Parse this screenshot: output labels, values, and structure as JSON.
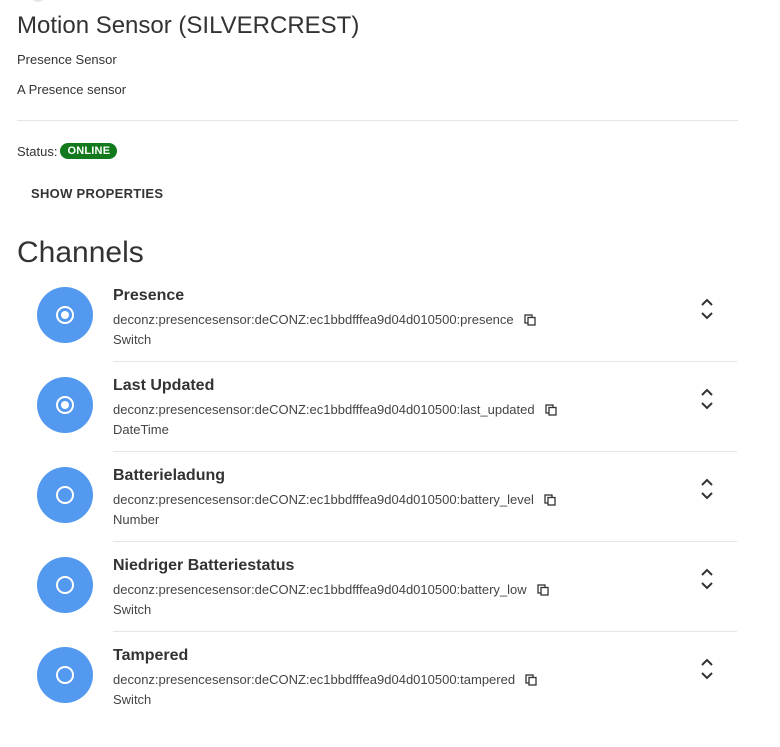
{
  "thing": {
    "title": "Motion Sensor (SILVERCREST)",
    "type_label": "Presence Sensor",
    "description": "A Presence sensor"
  },
  "status": {
    "label": "Status:",
    "value": "ONLINE",
    "color": "#127a1c"
  },
  "actions": {
    "show_properties": "SHOW PROPERTIES"
  },
  "channels_heading": "Channels",
  "accent": "#5399f0",
  "channels": [
    {
      "label": "Presence",
      "uid": "deconz:presencesensor:deCONZ:ec1bbdfffea9d04d010500:presence",
      "item_type": "Switch",
      "icon": "radio-checked-icon",
      "linked": true
    },
    {
      "label": "Last Updated",
      "uid": "deconz:presencesensor:deCONZ:ec1bbdfffea9d04d010500:last_updated",
      "item_type": "DateTime",
      "icon": "radio-checked-icon",
      "linked": true
    },
    {
      "label": "Batterieladung",
      "uid": "deconz:presencesensor:deCONZ:ec1bbdfffea9d04d010500:battery_level",
      "item_type": "Number",
      "icon": "radio-unchecked-icon",
      "linked": false
    },
    {
      "label": "Niedriger Batteriestatus",
      "uid": "deconz:presencesensor:deCONZ:ec1bbdfffea9d04d010500:battery_low",
      "item_type": "Switch",
      "icon": "radio-unchecked-icon",
      "linked": false
    },
    {
      "label": "Tampered",
      "uid": "deconz:presencesensor:deCONZ:ec1bbdfffea9d04d010500:tampered",
      "item_type": "Switch",
      "icon": "radio-unchecked-icon",
      "linked": false
    }
  ]
}
